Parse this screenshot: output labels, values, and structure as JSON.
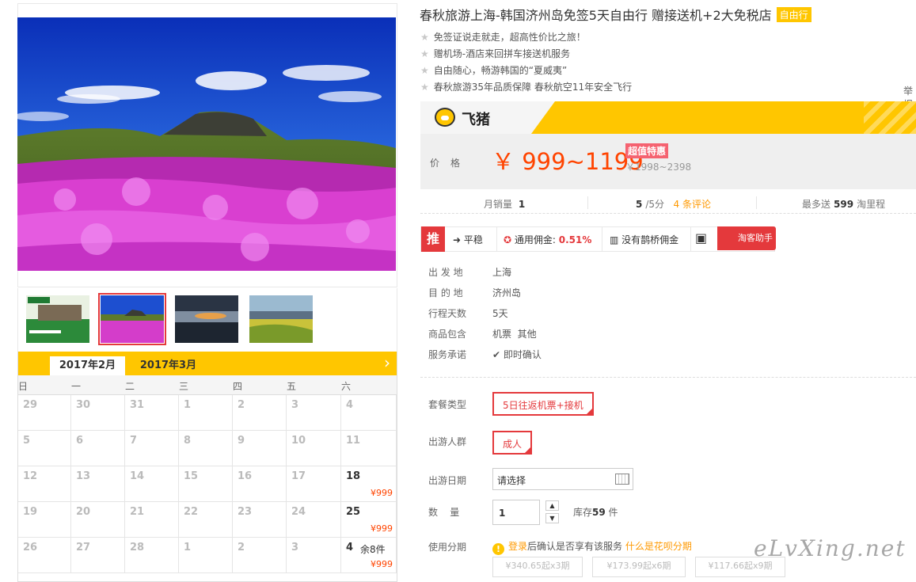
{
  "product": {
    "title": "春秋旅游上海-韩国济州岛免签5天自由行 赠接送机+2大免税店",
    "tag": "自由行",
    "features": [
      "免签证说走就走，超高性价比之旅！",
      "赠机场-酒店来回拼车接送机服务",
      "自由随心，畅游韩国的“夏威夷”",
      "春秋旅游35年品质保障 春秋航空11年安全飞行"
    ],
    "report": "举报"
  },
  "brand": {
    "name": "飞猪"
  },
  "price": {
    "label": "价格",
    "value": "￥ 999~1199",
    "tag": "超值特惠",
    "original": "￥1998~2398"
  },
  "stats": {
    "sales_label": "月销量",
    "sales_value": "1",
    "rating_value": "5",
    "rating_unit": "/5分",
    "reviews": "4 条评论",
    "points_prefix": "最多送",
    "points_value": "599",
    "points_suffix": "淘里程"
  },
  "toolbar": {
    "tui": "推",
    "trend": "平稳",
    "commission_label": "通用佣金:",
    "commission_value": "0.51%",
    "queqiao": "没有鹊桥佣金",
    "helper": "淘客助手"
  },
  "info": [
    {
      "label": "出 发 地",
      "value": "上海"
    },
    {
      "label": "目 的 地",
      "value": "济州岛"
    },
    {
      "label": "行程天数",
      "value": "5天"
    },
    {
      "label": "商品包含",
      "value": "机票  其他"
    },
    {
      "label": "服务承诺",
      "value": "即时确认"
    }
  ],
  "options": {
    "package_label": "套餐类型",
    "package_value": "5日往返机票+接机",
    "crowd_label": "出游人群",
    "crowd_value": "成人",
    "date_label": "出游日期",
    "date_placeholder": "请选择",
    "qty_label": "数    量",
    "qty_value": "1",
    "stock_prefix": "库存",
    "stock_value": "59",
    "stock_suffix": " 件",
    "inst_label": "使用分期",
    "inst_login": "登录",
    "inst_text": "后确认是否享有该服务 ",
    "inst_link": "什么是花呗分期",
    "inst_options": [
      "¥340.65起x3期",
      "¥173.99起x6期",
      "¥117.66起x9期"
    ]
  },
  "calendar": {
    "tabs": [
      "2017年2月",
      "2017年3月"
    ],
    "weekdays": [
      "日",
      "一",
      "二",
      "三",
      "四",
      "五",
      "六"
    ],
    "rows": [
      [
        {
          "d": "29"
        },
        {
          "d": "30"
        },
        {
          "d": "31"
        },
        {
          "d": "1"
        },
        {
          "d": "2"
        },
        {
          "d": "3"
        },
        {
          "d": "4"
        }
      ],
      [
        {
          "d": "5"
        },
        {
          "d": "6"
        },
        {
          "d": "7"
        },
        {
          "d": "8"
        },
        {
          "d": "9"
        },
        {
          "d": "10"
        },
        {
          "d": "11"
        }
      ],
      [
        {
          "d": "12"
        },
        {
          "d": "13"
        },
        {
          "d": "14"
        },
        {
          "d": "15"
        },
        {
          "d": "16"
        },
        {
          "d": "17"
        },
        {
          "d": "18",
          "p": "¥999",
          "on": true
        }
      ],
      [
        {
          "d": "19"
        },
        {
          "d": "20"
        },
        {
          "d": "21"
        },
        {
          "d": "22"
        },
        {
          "d": "23"
        },
        {
          "d": "24"
        },
        {
          "d": "25",
          "p": "¥999",
          "on": true
        }
      ],
      [
        {
          "d": "26"
        },
        {
          "d": "27"
        },
        {
          "d": "28"
        },
        {
          "d": "1"
        },
        {
          "d": "2"
        },
        {
          "d": "3"
        },
        {
          "d": "4",
          "p": "¥999",
          "on": true,
          "r": "余8件"
        }
      ]
    ]
  },
  "watermark": "eLvXing.net"
}
